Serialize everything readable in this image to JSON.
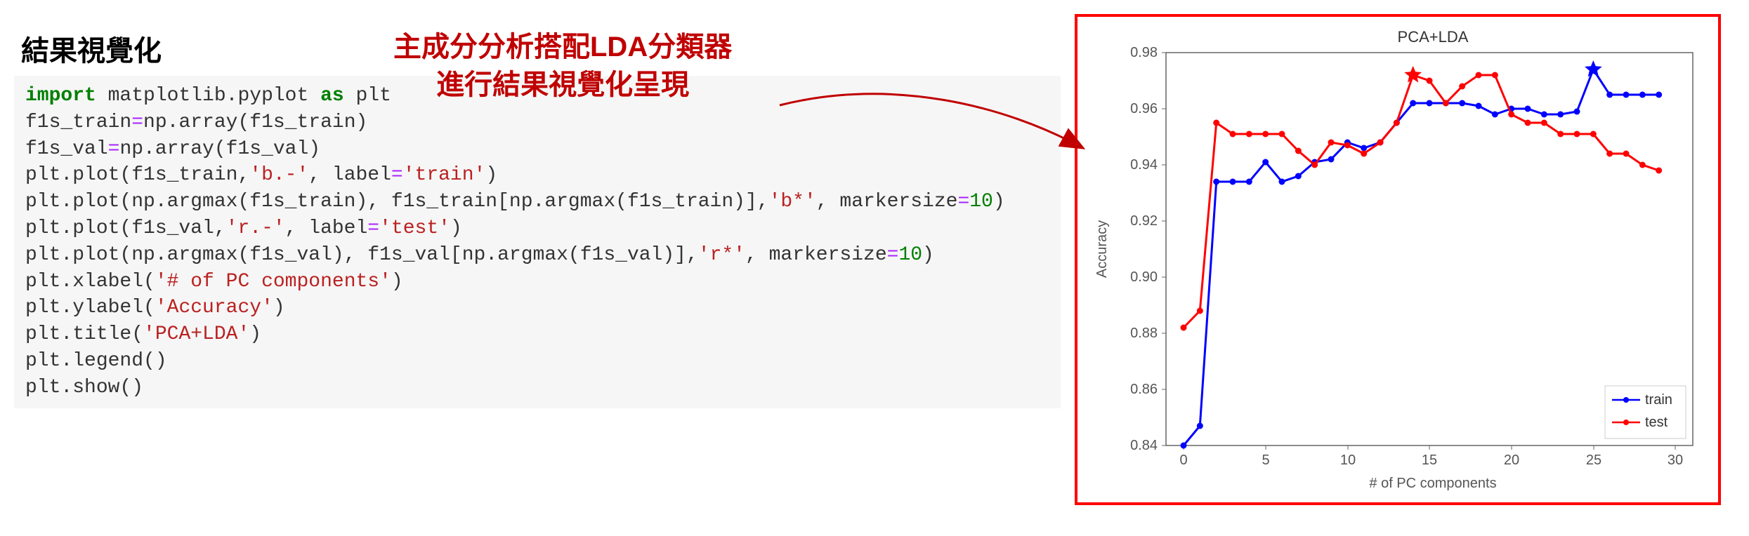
{
  "heading": "結果視覺化",
  "annotation_line1": "主成分分析搭配LDA分類器",
  "annotation_line2": "進行結果視覺化呈現",
  "code": {
    "l1_import": "import",
    "l1_mod": " matplotlib.pyplot ",
    "l1_as": "as",
    "l1_alias": " plt",
    "l2": "f1s_train",
    "l2_eq": "=",
    "l2_rest": "np.array(f1s_train)",
    "l3": "f1s_val",
    "l3_eq": "=",
    "l3_rest": "np.array(f1s_val)",
    "l4_a": "plt.plot(f1s_train,",
    "l4_s": "'b.-'",
    "l4_b": ", label",
    "l4_eq": "=",
    "l4_s2": "'train'",
    "l4_c": ")",
    "l5_a": "plt.plot(np.argmax(f1s_train), f1s_train[np.argmax(f1s_train)],",
    "l5_s": "'b*'",
    "l5_b": ", markersize",
    "l5_eq": "=",
    "l5_n": "10",
    "l5_c": ")",
    "l6_a": "plt.plot(f1s_val,",
    "l6_s": "'r.-'",
    "l6_b": ", label",
    "l6_eq": "=",
    "l6_s2": "'test'",
    "l6_c": ")",
    "l7_a": "plt.plot(np.argmax(f1s_val), f1s_val[np.argmax(f1s_val)],",
    "l7_s": "'r*'",
    "l7_b": ", markersize",
    "l7_eq": "=",
    "l7_n": "10",
    "l7_c": ")",
    "l8_a": "plt.xlabel(",
    "l8_s": "'# of PC components'",
    "l8_c": ")",
    "l9_a": "plt.ylabel(",
    "l9_s": "'Accuracy'",
    "l9_c": ")",
    "l10_a": "plt.title(",
    "l10_s": "'PCA+LDA'",
    "l10_c": ")",
    "l11": "plt.legend()",
    "l12": "plt.show()"
  },
  "chart_data": {
    "type": "line",
    "title": "PCA+LDA",
    "xlabel": "# of PC components",
    "ylabel": "Accuracy",
    "xlim": [
      0,
      30
    ],
    "ylim": [
      0.84,
      0.98
    ],
    "x": [
      0,
      1,
      2,
      3,
      4,
      5,
      6,
      7,
      8,
      9,
      10,
      11,
      12,
      13,
      14,
      15,
      16,
      17,
      18,
      19,
      20,
      21,
      22,
      23,
      24,
      25,
      26,
      27,
      28,
      29
    ],
    "xticks": [
      0,
      5,
      10,
      15,
      20,
      25,
      30
    ],
    "yticks": [
      0.84,
      0.86,
      0.88,
      0.9,
      0.92,
      0.94,
      0.96,
      0.98
    ],
    "series": [
      {
        "name": "train",
        "color": "#0000FF",
        "marker": ".",
        "values": [
          0.84,
          0.847,
          0.934,
          0.934,
          0.934,
          0.941,
          0.934,
          0.936,
          0.941,
          0.942,
          0.948,
          0.946,
          0.948,
          0.955,
          0.962,
          0.962,
          0.962,
          0.962,
          0.961,
          0.958,
          0.96,
          0.96,
          0.958,
          0.958,
          0.959,
          0.974,
          0.965,
          0.965,
          0.965,
          0.965
        ],
        "star_x": 25,
        "star_y": 0.974
      },
      {
        "name": "test",
        "color": "#FF0000",
        "marker": ".",
        "values": [
          0.882,
          0.888,
          0.955,
          0.951,
          0.951,
          0.951,
          0.951,
          0.945,
          0.94,
          0.948,
          0.947,
          0.944,
          0.948,
          0.955,
          0.972,
          0.97,
          0.962,
          0.968,
          0.972,
          0.972,
          0.958,
          0.955,
          0.955,
          0.951,
          0.951,
          0.951,
          0.944,
          0.944,
          0.94,
          0.938
        ],
        "star_x": 14,
        "star_y": 0.972
      }
    ],
    "legend_position": "lower-right"
  },
  "yt": {
    "t0": "0.84",
    "t1": "0.86",
    "t2": "0.88",
    "t3": "0.90",
    "t4": "0.92",
    "t5": "0.94",
    "t6": "0.96",
    "t7": "0.98"
  },
  "xt": {
    "t0": "0",
    "t1": "5",
    "t2": "10",
    "t3": "15",
    "t4": "20",
    "t5": "25",
    "t6": "30"
  }
}
